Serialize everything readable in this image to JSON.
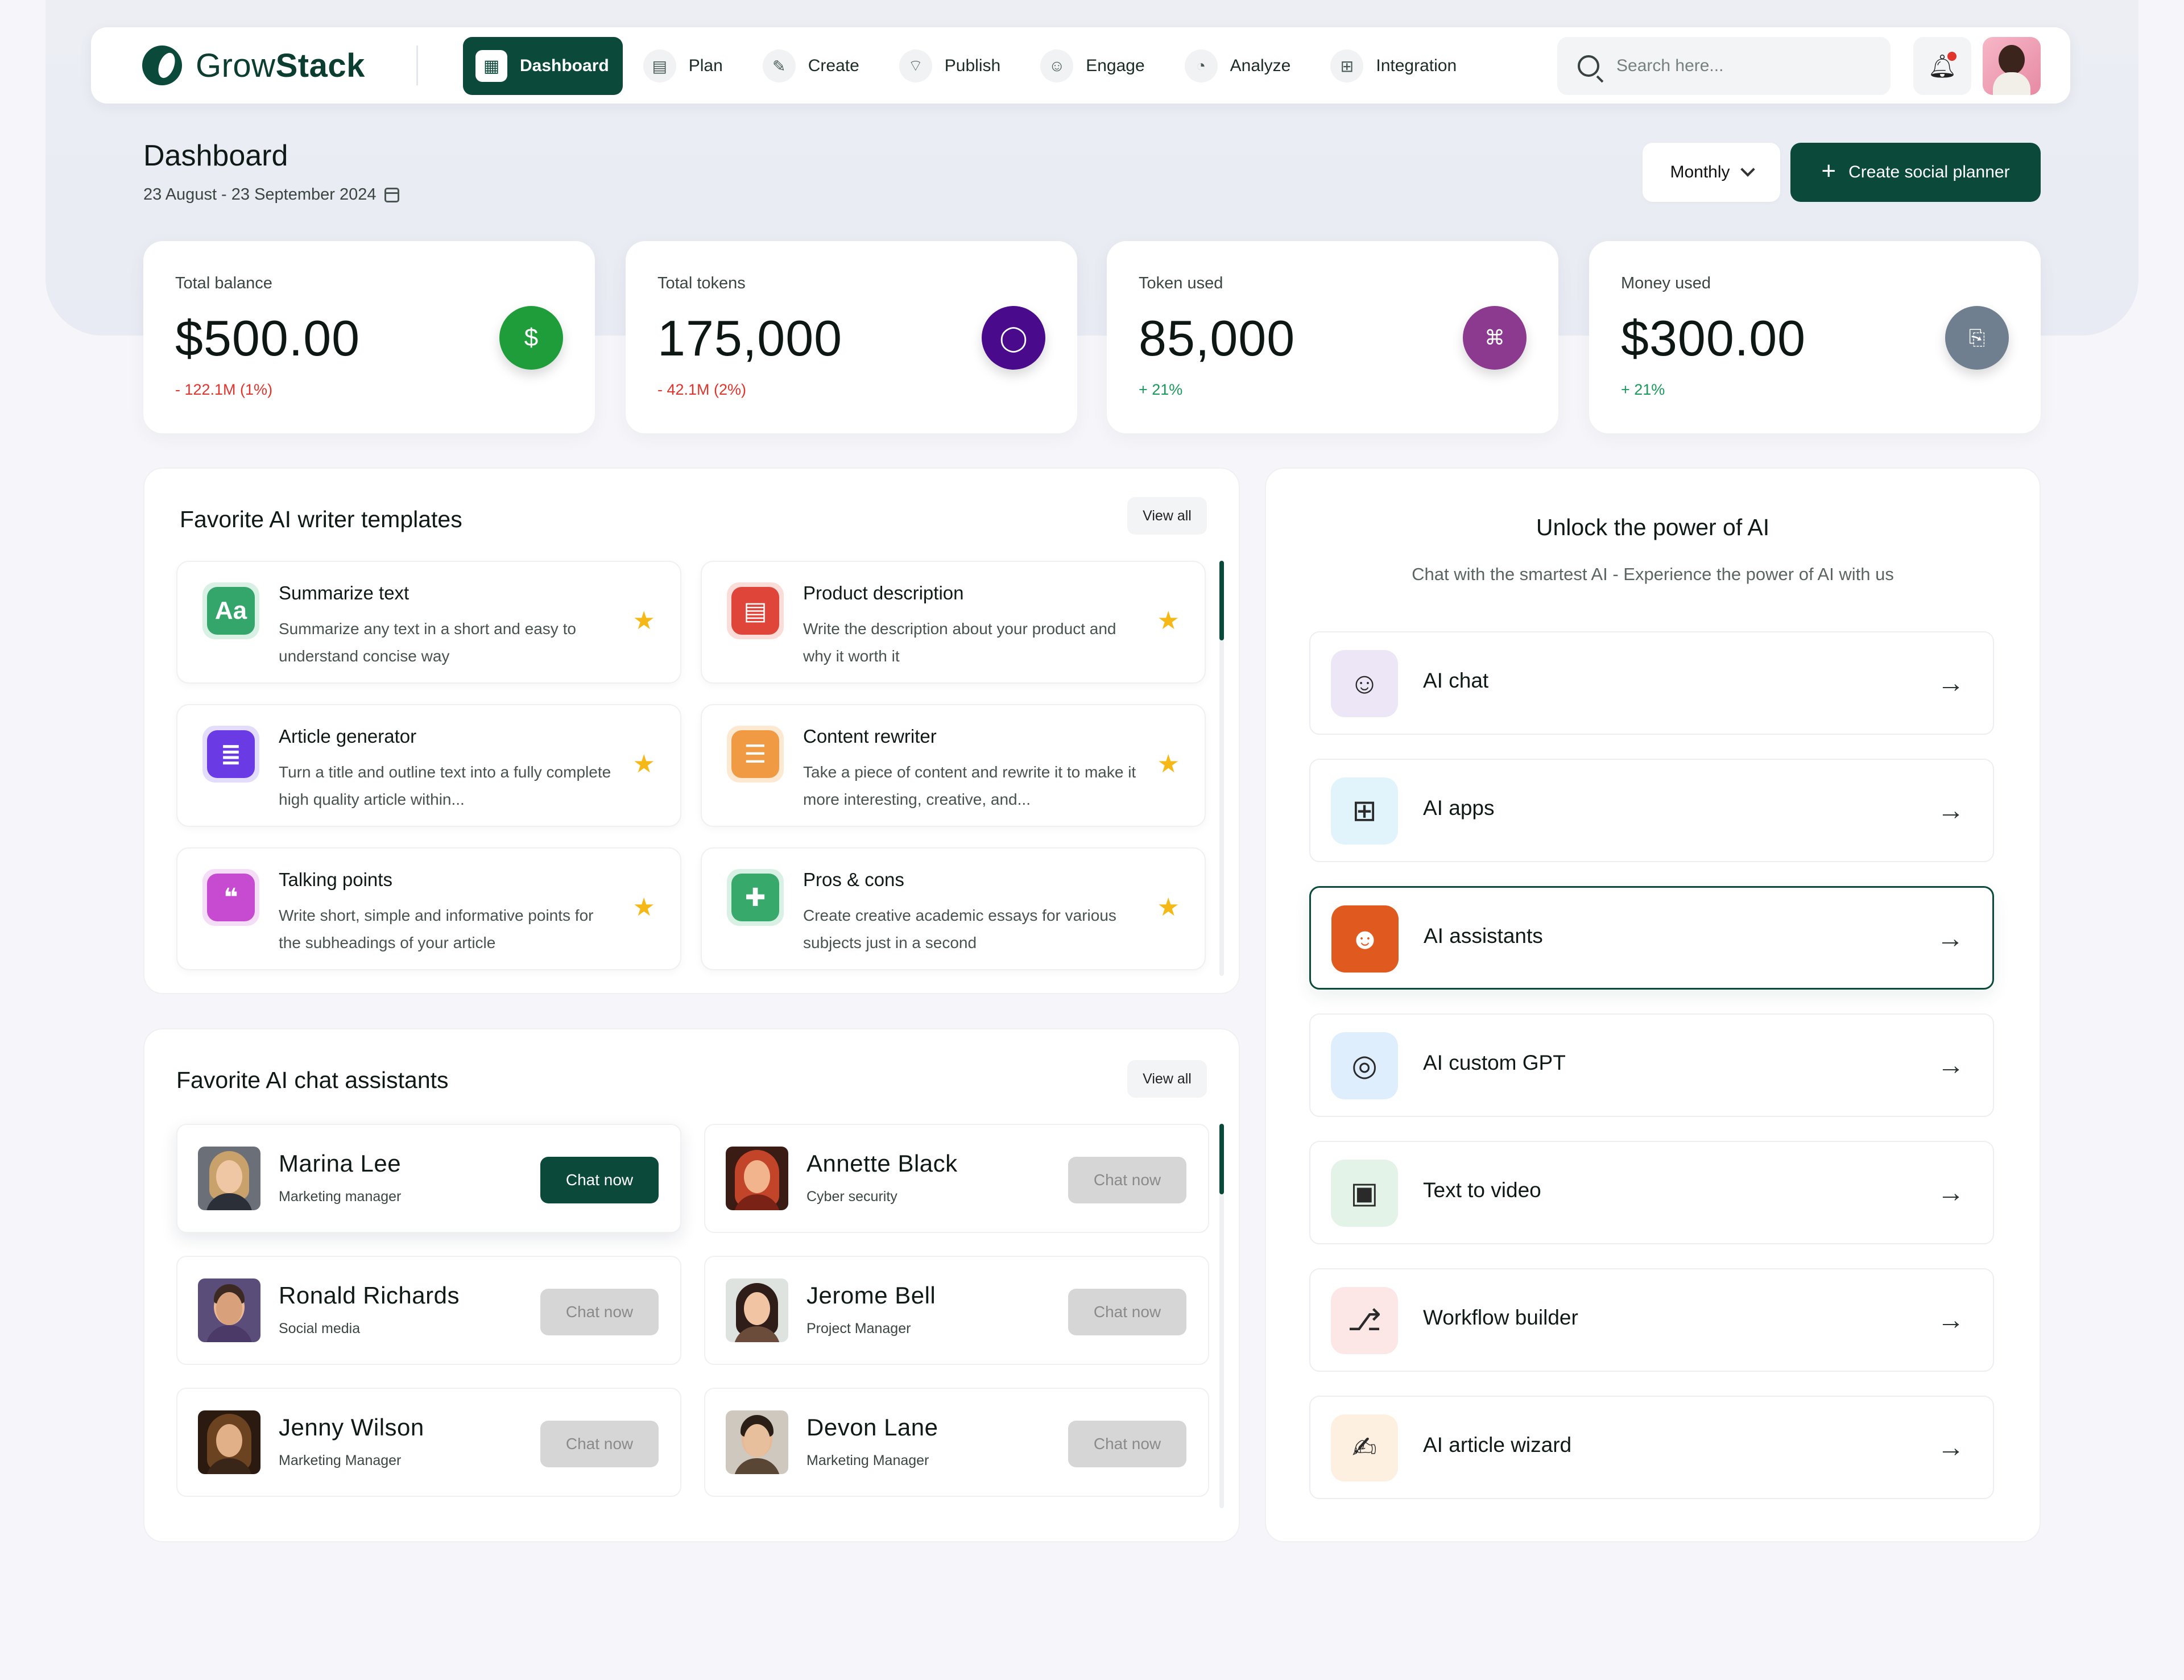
{
  "brand": {
    "name_light": "Grow",
    "name_bold": "Stack"
  },
  "nav": {
    "items": [
      {
        "label": "Dashboard",
        "icon": "dashboard-grid-icon"
      },
      {
        "label": "Plan",
        "icon": "plan-icon"
      },
      {
        "label": "Create",
        "icon": "pencil-icon"
      },
      {
        "label": "Publish",
        "icon": "broadcast-icon"
      },
      {
        "label": "Engage",
        "icon": "users-icon"
      },
      {
        "label": "Analyze",
        "icon": "pie-chart-icon"
      },
      {
        "label": "Integration",
        "icon": "plug-icon"
      }
    ],
    "search_placeholder": "Search here..."
  },
  "header": {
    "title": "Dashboard",
    "date_range": "23 August - 23 September 2024",
    "period_select": "Monthly",
    "create_button": "Create social planner"
  },
  "stats": [
    {
      "label": "Total balance",
      "value": "$500.00",
      "change": "- 122.1M (1%)",
      "trend": "down",
      "icon": "dollar-icon",
      "color": "#1f9d3a"
    },
    {
      "label": "Total tokens",
      "value": "175,000",
      "change": "- 42.1M (2%)",
      "trend": "down",
      "icon": "token-icon",
      "color": "#4a0a8c"
    },
    {
      "label": "Token used",
      "value": "85,000",
      "change": "+ 21%",
      "trend": "up",
      "icon": "coins-hand-icon",
      "color": "#8b3a8f"
    },
    {
      "label": "Money used",
      "value": "$300.00",
      "change": "+ 21%",
      "trend": "up",
      "icon": "money-hand-icon",
      "color": "#6f7f90"
    }
  ],
  "templates": {
    "title": "Favorite AI writer templates",
    "view_all": "View all",
    "items": [
      {
        "name": "Summarize text",
        "desc": "Summarize any text in a short and easy to understand concise way",
        "icon": "text-aa-icon",
        "color": "#34a56b"
      },
      {
        "name": "Product description",
        "desc": "Write the description about your product and why it worth it",
        "icon": "document-icon",
        "color": "#e0453a"
      },
      {
        "name": "Article generator",
        "desc": "Turn a title and outline text into a fully complete high quality article within...",
        "icon": "article-icon",
        "color": "#6a3be4"
      },
      {
        "name": "Content rewriter",
        "desc": "Take a piece of content and rewrite it to make it more interesting, creative, and...",
        "icon": "rewrite-icon",
        "color": "#f09a43"
      },
      {
        "name": "Talking points",
        "desc": "Write short, simple and informative points for the subheadings of your article",
        "icon": "speech-bubble-icon",
        "color": "#c74bd0"
      },
      {
        "name": "Pros & cons",
        "desc": "Create creative academic essays for various subjects just in a second",
        "icon": "thumbs-icon",
        "color": "#37a96b"
      }
    ]
  },
  "assistants": {
    "title": "Favorite AI chat assistants",
    "view_all": "View all",
    "items": [
      {
        "name": "Marina Lee",
        "role": "Marketing manager",
        "button": "Chat now",
        "primary": true,
        "hair": "#c9a26b",
        "shirt": "#2b2f37"
      },
      {
        "name": "Annette Black",
        "role": "Cyber security",
        "button": "Chat now",
        "primary": false,
        "hair": "#c2452a",
        "shirt": "#7b2216"
      },
      {
        "name": "Ronald Richards",
        "role": "Social media",
        "button": "Chat now",
        "primary": false,
        "hair": "#3c2a22",
        "shirt": "#4b3a67"
      },
      {
        "name": "Jerome Bell",
        "role": "Project Manager",
        "button": "Chat now",
        "primary": false,
        "hair": "#2e1d18",
        "shirt": "#6b4b3a"
      },
      {
        "name": "Jenny Wilson",
        "role": "Marketing Manager",
        "button": "Chat now",
        "primary": false,
        "hair": "#6b4321",
        "shirt": "#3a2618"
      },
      {
        "name": "Devon Lane",
        "role": "Marketing Manager",
        "button": "Chat now",
        "primary": false,
        "hair": "#2b1e17",
        "shirt": "#5a4634"
      }
    ]
  },
  "ai_power": {
    "title": "Unlock the power of AI",
    "subtitle": "Chat with the smartest AI - Experience the power of AI with us",
    "items": [
      {
        "label": "AI chat",
        "icon": "robot-icon",
        "bg": "#ece6f7",
        "fg": "#2a2a2a"
      },
      {
        "label": "AI apps",
        "icon": "apps-grid-icon",
        "bg": "#e2f4fb",
        "fg": "#2a2a2a"
      },
      {
        "label": "AI assistants",
        "icon": "assistant-robot-icon",
        "bg": "#e05a1f",
        "fg": "#ffffff"
      },
      {
        "label": "AI custom GPT",
        "icon": "gpt-icon",
        "bg": "#dfeefc",
        "fg": "#2a2a2a"
      },
      {
        "label": "Text to video",
        "icon": "text-video-icon",
        "bg": "#e3f3e8",
        "fg": "#2a2a2a"
      },
      {
        "label": "Workflow builder",
        "icon": "workflow-icon",
        "bg": "#fde6e6",
        "fg": "#2a2a2a"
      },
      {
        "label": "AI article wizard",
        "icon": "article-wizard-icon",
        "bg": "#fdf0e0",
        "fg": "#2a2a2a"
      }
    ]
  }
}
